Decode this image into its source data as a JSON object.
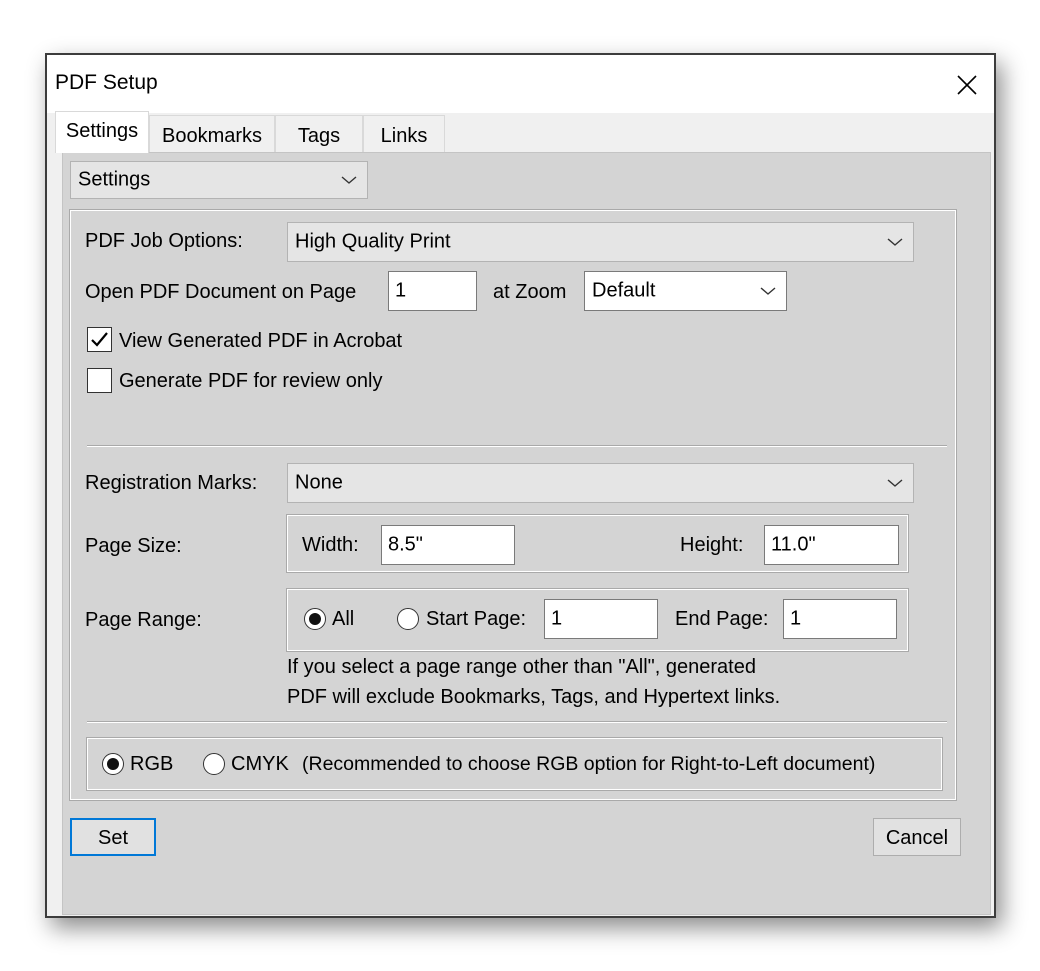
{
  "window": {
    "title": "PDF Setup"
  },
  "tabs": [
    {
      "label": "Settings",
      "active": true
    },
    {
      "label": "Bookmarks",
      "active": false
    },
    {
      "label": "Tags",
      "active": false
    },
    {
      "label": "Links",
      "active": false
    }
  ],
  "section_select": {
    "value": "Settings"
  },
  "job_options": {
    "label": "PDF Job Options:",
    "value": "High Quality Print"
  },
  "open_page": {
    "label": "Open PDF Document on Page",
    "page_value": "1",
    "zoom_label": "at Zoom",
    "zoom_value": "Default"
  },
  "view_in_acrobat": {
    "label": "View Generated PDF in Acrobat",
    "checked": true
  },
  "review_only": {
    "label": "Generate PDF for review only",
    "checked": false
  },
  "registration_marks": {
    "label": "Registration Marks:",
    "value": "None"
  },
  "page_size": {
    "label": "Page Size:",
    "width_label": "Width:",
    "width_value": "8.5\"",
    "height_label": "Height:",
    "height_value": "11.0\""
  },
  "page_range": {
    "label": "Page Range:",
    "all_label": "All",
    "start_label": "Start Page:",
    "start_value": "1",
    "end_label": "End Page:",
    "end_value": "1",
    "selected": "All",
    "note_line1": "If you select a page range other than \"All\",  generated",
    "note_line2": "PDF will exclude Bookmarks, Tags, and Hypertext links."
  },
  "color_mode": {
    "rgb_label": "RGB",
    "cmyk_label": "CMYK",
    "note": "(Recommended to choose RGB option for Right-to-Left document)",
    "selected": "RGB"
  },
  "buttons": {
    "set": "Set",
    "cancel": "Cancel"
  },
  "colors": {
    "accent": "#0078d7",
    "panel": "#d4d4d4",
    "window": "#f0f0f0"
  }
}
